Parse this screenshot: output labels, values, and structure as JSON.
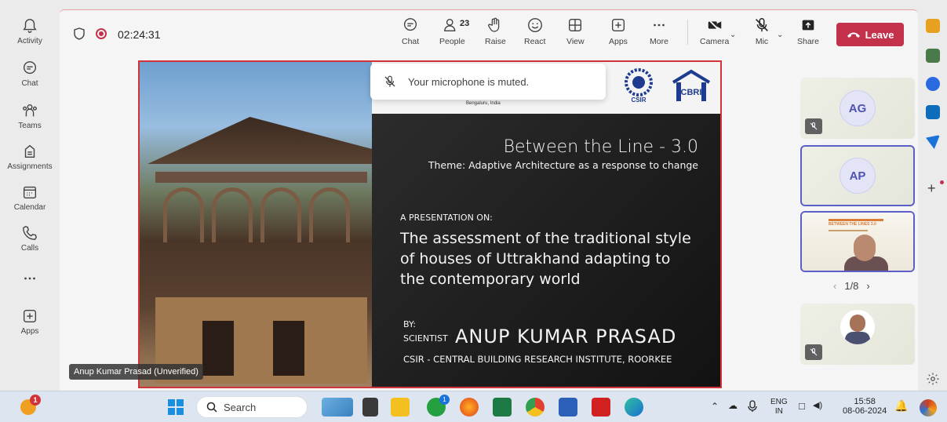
{
  "rail": {
    "items": [
      {
        "label": "Activity",
        "icon": "bell-icon"
      },
      {
        "label": "Chat",
        "icon": "chat-icon"
      },
      {
        "label": "Teams",
        "icon": "teams-icon"
      },
      {
        "label": "Assignments",
        "icon": "assignments-icon"
      },
      {
        "label": "Calendar",
        "icon": "calendar-icon"
      },
      {
        "label": "Calls",
        "icon": "phone-icon"
      },
      {
        "label": "",
        "icon": "more-icon"
      },
      {
        "label": "Apps",
        "icon": "add-app-icon"
      }
    ]
  },
  "meeting": {
    "timer": "02:24:31",
    "people_count": "23",
    "buttons": {
      "chat": "Chat",
      "people": "People",
      "raise": "Raise",
      "react": "React",
      "view": "View",
      "apps": "Apps",
      "more": "More",
      "camera": "Camera",
      "mic": "Mic",
      "share": "Share",
      "leave": "Leave"
    },
    "toast": "Your microphone is muted.",
    "presenter_tag": "Anup Kumar Prasad (Unverified)"
  },
  "slide": {
    "header_small": "Bengaluru, India",
    "csir_logo_text": "CSIR",
    "cbri_logo_text": "CBRI",
    "title": "Between the Line - 3.0",
    "theme": "Theme: Adaptive Architecture as a response to change",
    "pre": "A PRESENTATION ON:",
    "main_line1": "The assessment of the traditional style",
    "main_line2": "of houses of Uttrakhand adapting to",
    "main_line3": "the contemporary world",
    "by": "BY:",
    "scientist": "SCIENTIST",
    "name": "ANUP  KUMAR  PRASAD",
    "institute": "CSIR - CENTRAL BUILDING RESEARCH INSTITUTE, ROORKEE"
  },
  "participants": {
    "tiles": [
      {
        "initials": "AG",
        "muted": true
      },
      {
        "initials": "AP",
        "muted": false
      },
      {
        "thumb_title": "BETWEEN THE LINES 3.0"
      },
      {
        "muted": true
      }
    ],
    "pager": "1/8"
  },
  "taskbar": {
    "search_label": "Search",
    "notification_count": "1",
    "whatsapp_badge": "1",
    "lang_top": "ENG",
    "lang_bottom": "IN",
    "time": "15:58",
    "date": "08-06-2024"
  },
  "colors": {
    "leave": "#c4314b",
    "accent": "#5b5fc7",
    "slide_border": "#d13438"
  }
}
